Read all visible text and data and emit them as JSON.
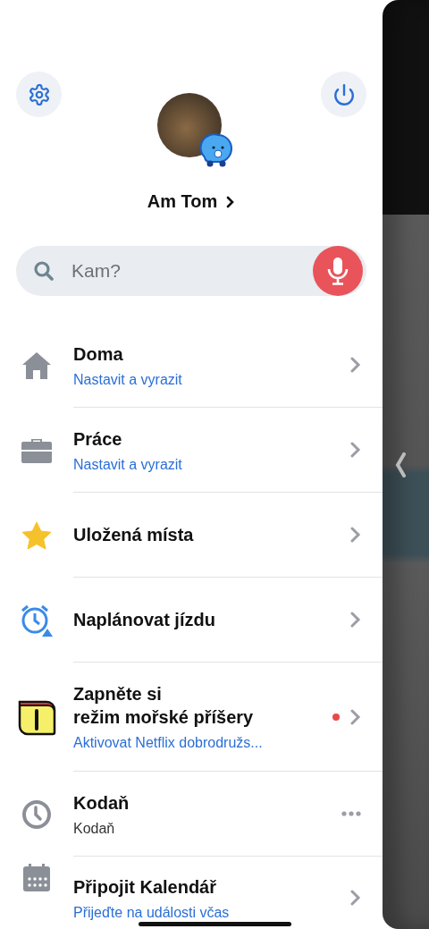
{
  "profile": {
    "name": "Am Tom"
  },
  "search": {
    "placeholder": "Kam?"
  },
  "menu": [
    {
      "title": "Doma",
      "subtitle": {
        "text": "Nastavit a vyrazit",
        "kind": "action"
      },
      "kind": "chevron",
      "notification": false
    },
    {
      "title": "Práce",
      "subtitle": {
        "text": "Nastavit a vyrazit",
        "kind": "action"
      },
      "kind": "chevron",
      "notification": false
    },
    {
      "title": "Uložená místa",
      "kind": "chevron",
      "notification": false
    },
    {
      "title": "Naplánovat jízdu",
      "kind": "chevron",
      "notification": false
    },
    {
      "title": "Zapněte si\nrežim mořské příšery",
      "subtitle": {
        "text": "Aktivovat Netflix dobrodružs...",
        "kind": "action"
      },
      "kind": "chevron",
      "notification": true
    },
    {
      "title": "Kodaň",
      "subtitle": {
        "text": "Kodaň",
        "kind": "info"
      },
      "kind": "more",
      "notification": false
    },
    {
      "title": "Připojit Kalendář",
      "subtitle": {
        "text": "Přijeďte na události včas",
        "kind": "action"
      },
      "kind": "chevron",
      "notification": false
    }
  ]
}
